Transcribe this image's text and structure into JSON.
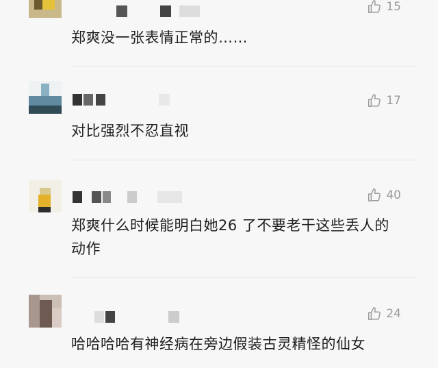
{
  "comments": [
    {
      "text": "郑爽没一张表情正常的……",
      "likes": "15"
    },
    {
      "text": "对比强烈不忍直视",
      "likes": "17"
    },
    {
      "text": "郑爽什么时候能明白她26 了不要老干这些丢人的动作",
      "likes": "40"
    },
    {
      "text": "哈哈哈哈有神经病在旁边假装古灵精怪的仙女",
      "likes": "24"
    }
  ],
  "icons": {
    "like": "thumbs-up-icon"
  },
  "colors": {
    "background": "#f7f7f7",
    "text": "#1e1e1e",
    "muted": "#9a9a9a",
    "divider": "#e4e4e4"
  }
}
